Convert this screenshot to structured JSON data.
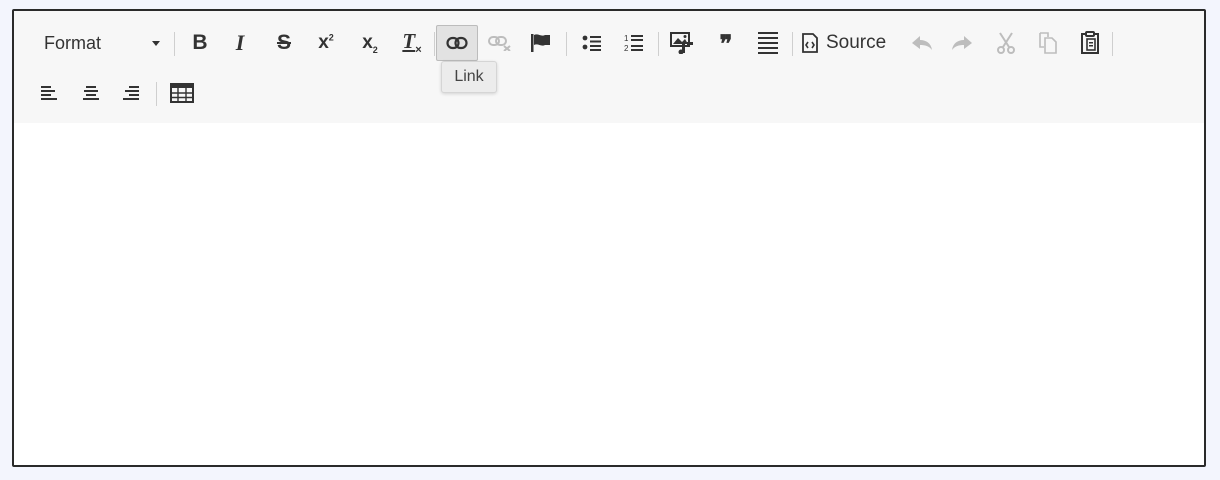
{
  "toolbar": {
    "format_label": "Format",
    "source_label": "Source",
    "buttons": {
      "bold": "B",
      "italic": "I",
      "strike": "S",
      "superscript": "x",
      "subscript": "x",
      "remove_format": "T",
      "blockquote": "❞"
    },
    "active_button": "link",
    "disabled_buttons": [
      "unlink",
      "undo",
      "redo",
      "cut",
      "copy"
    ]
  },
  "tooltip": {
    "text": "Link"
  },
  "editor": {
    "content": ""
  },
  "colors": {
    "toolbar_bg": "#f7f7f7",
    "border": "#2a2a2a",
    "page_bg": "#f3f5fd",
    "icon": "#333333",
    "icon_disabled": "#bdbdbd"
  }
}
